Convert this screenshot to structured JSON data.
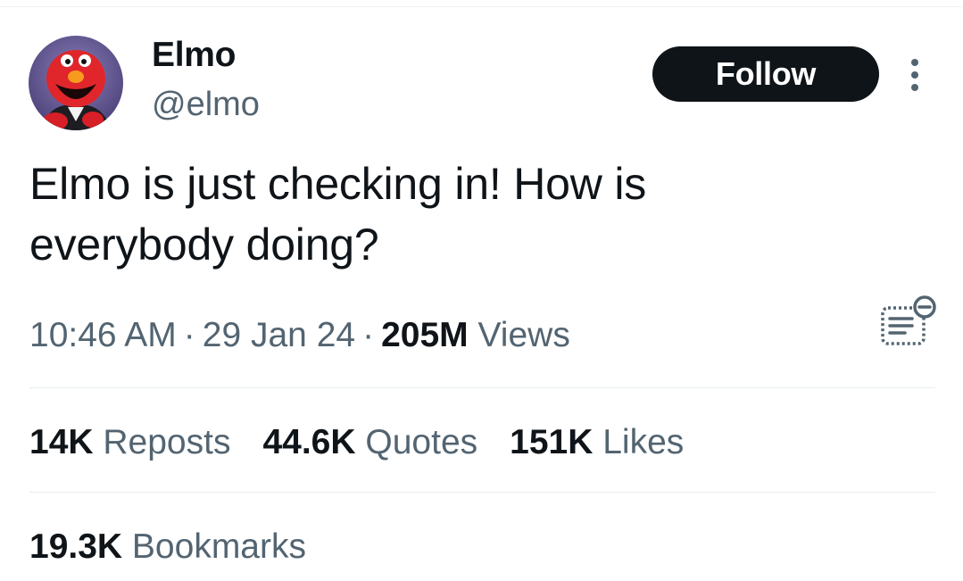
{
  "author": {
    "name": "Elmo",
    "handle": "@elmo",
    "avatar_icon": "elmo-avatar"
  },
  "actions": {
    "follow_label": "Follow",
    "more_icon": "more-vertical-icon"
  },
  "tweet": {
    "text": "Elmo is just checking in! How is everybody doing?",
    "time": "10:46 AM",
    "date": "29 Jan 24",
    "views_count": "205M",
    "views_label": "Views",
    "separator": "·",
    "notes_icon": "community-notes-icon"
  },
  "stats": {
    "reposts_count": "14K",
    "reposts_label": "Reposts",
    "quotes_count": "44.6K",
    "quotes_label": "Quotes",
    "likes_count": "151K",
    "likes_label": "Likes",
    "bookmarks_count": "19.3K",
    "bookmarks_label": "Bookmarks"
  },
  "colors": {
    "text_primary": "#0f1419",
    "text_secondary": "#536471",
    "follow_bg": "#0f1419",
    "divider": "#e6ecf0"
  }
}
